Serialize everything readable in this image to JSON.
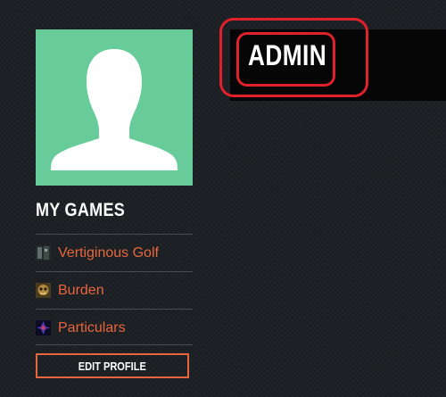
{
  "profile": {
    "username": "ADMIN",
    "avatar_icon": "default-user-silhouette-icon",
    "avatar_bg": "#67cc9a"
  },
  "games": {
    "title": "MY GAMES",
    "items": [
      {
        "label": "Vertiginous Golf",
        "icon": "vertiginous-golf-thumbnail"
      },
      {
        "label": "Burden",
        "icon": "burden-thumbnail"
      },
      {
        "label": "Particulars",
        "icon": "particulars-thumbnail"
      }
    ]
  },
  "actions": {
    "edit_profile_label": "EDIT PROFILE"
  },
  "colors": {
    "accent": "#e8663d",
    "annotation": "#e0202a",
    "background": "#1d2125"
  }
}
